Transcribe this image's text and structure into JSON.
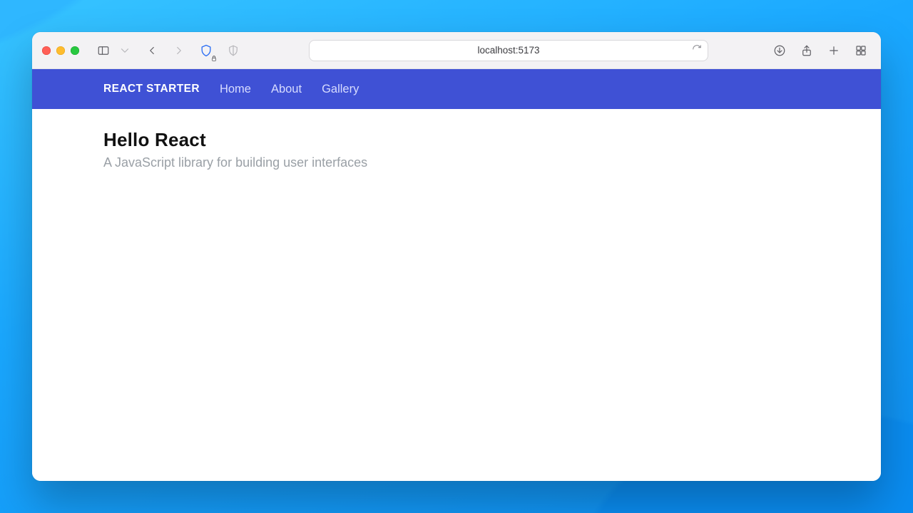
{
  "browser": {
    "address": "localhost:5173"
  },
  "app": {
    "brand": "REACT STARTER",
    "nav": [
      {
        "label": "Home"
      },
      {
        "label": "About"
      },
      {
        "label": "Gallery"
      }
    ],
    "page": {
      "title": "Hello React",
      "subtitle": "A JavaScript library for building user interfaces"
    }
  },
  "colors": {
    "appbar": "#3f51d5"
  }
}
